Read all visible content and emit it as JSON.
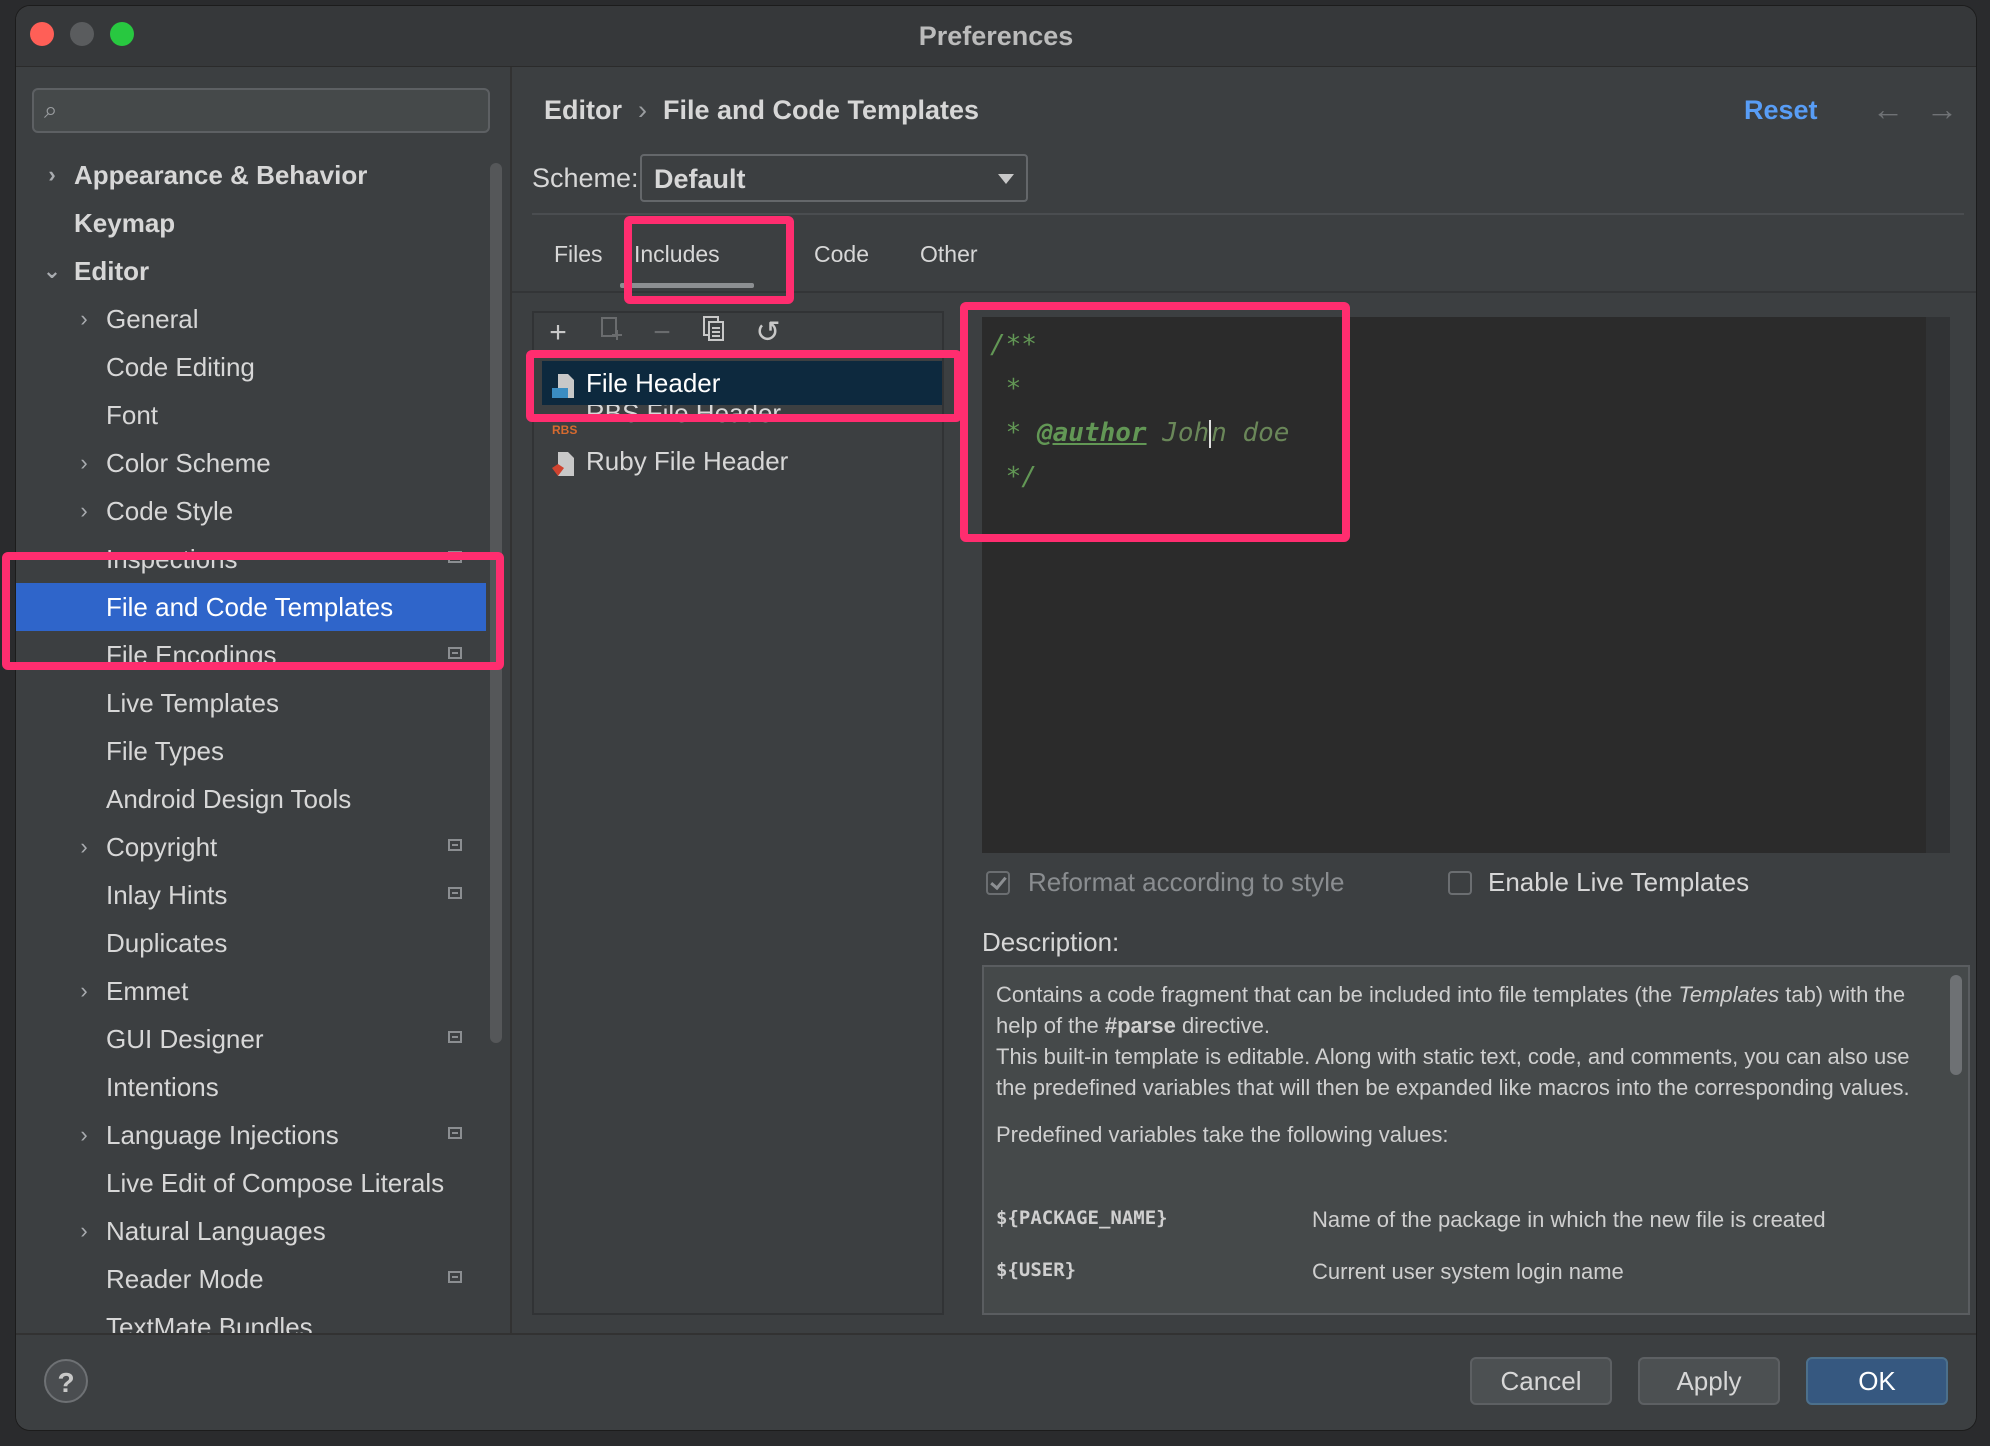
{
  "window": {
    "title": "Preferences"
  },
  "sidebar": {
    "search_placeholder": "",
    "items": [
      {
        "label": "Appearance & Behavior",
        "level": 0,
        "arrow": "›",
        "bold": true
      },
      {
        "label": "Keymap",
        "level": 0,
        "arrow": "",
        "bold": true
      },
      {
        "label": "Editor",
        "level": 0,
        "arrow": "⌄",
        "bold": true
      },
      {
        "label": "General",
        "level": 1,
        "arrow": "›"
      },
      {
        "label": "Code Editing",
        "level": 1,
        "arrow": ""
      },
      {
        "label": "Font",
        "level": 1,
        "arrow": ""
      },
      {
        "label": "Color Scheme",
        "level": 1,
        "arrow": "›"
      },
      {
        "label": "Code Style",
        "level": 1,
        "arrow": "›"
      },
      {
        "label": "Inspections",
        "level": 1,
        "arrow": "",
        "badge": true
      },
      {
        "label": "File and Code Templates",
        "level": 1,
        "arrow": "",
        "selected": true
      },
      {
        "label": "File Encodings",
        "level": 1,
        "arrow": "",
        "badge": true
      },
      {
        "label": "Live Templates",
        "level": 1,
        "arrow": ""
      },
      {
        "label": "File Types",
        "level": 1,
        "arrow": ""
      },
      {
        "label": "Android Design Tools",
        "level": 1,
        "arrow": ""
      },
      {
        "label": "Copyright",
        "level": 1,
        "arrow": "›",
        "badge": true
      },
      {
        "label": "Inlay Hints",
        "level": 1,
        "arrow": "",
        "badge": true
      },
      {
        "label": "Duplicates",
        "level": 1,
        "arrow": ""
      },
      {
        "label": "Emmet",
        "level": 1,
        "arrow": "›"
      },
      {
        "label": "GUI Designer",
        "level": 1,
        "arrow": "",
        "badge": true
      },
      {
        "label": "Intentions",
        "level": 1,
        "arrow": ""
      },
      {
        "label": "Language Injections",
        "level": 1,
        "arrow": "›",
        "badge": true
      },
      {
        "label": "Live Edit of Compose Literals",
        "level": 1,
        "arrow": ""
      },
      {
        "label": "Natural Languages",
        "level": 1,
        "arrow": "›"
      },
      {
        "label": "Reader Mode",
        "level": 1,
        "arrow": "",
        "badge": true
      },
      {
        "label": "TextMate Bundles",
        "level": 1,
        "arrow": ""
      }
    ]
  },
  "breadcrumb": {
    "parent": "Editor",
    "separator": "›",
    "current": "File and Code Templates"
  },
  "header": {
    "reset_label": "Reset",
    "back_glyph": "←",
    "forward_glyph": "→"
  },
  "scheme": {
    "label": "Scheme:",
    "value": "Default"
  },
  "tabs": [
    {
      "label": "Files"
    },
    {
      "label": "Includes",
      "active": true
    },
    {
      "label": "Code"
    },
    {
      "label": "Other"
    }
  ],
  "toolbar": {
    "add": "+",
    "remove": "−",
    "revert": "↺"
  },
  "templates": [
    {
      "label": "File Header",
      "selected": true,
      "icon": "java-file-icon"
    },
    {
      "label": "RBS File Header",
      "icon": "rbs-file-icon"
    },
    {
      "label": "Ruby File Header",
      "icon": "ruby-file-icon"
    }
  ],
  "editor": {
    "lines": [
      "/**",
      " *",
      " * ",
      " */"
    ],
    "author_tag": "@author",
    "author_value_before_cursor": " Joh",
    "author_value_after_cursor": "n doe"
  },
  "options": {
    "reformat_label": "Reformat according to style",
    "reformat_checked": true,
    "live_templates_label": "Enable Live Templates",
    "live_templates_checked": false
  },
  "description": {
    "label": "Description:",
    "p1_a": "Contains a code fragment that can be included into file templates (the ",
    "p1_em": "Templates",
    "p1_b": " tab) with the help of the ",
    "p1_strong": "#parse",
    "p1_c": " directive.",
    "p2": "This built-in template is editable. Along with static text, code, and comments, you can also use the predefined variables that will then be expanded like macros into the corresponding values.",
    "p3": "Predefined variables take the following values:",
    "vars": [
      {
        "name": "${PACKAGE_NAME}",
        "desc": "Name of the package in which the new file is created"
      },
      {
        "name": "${USER}",
        "desc": "Current user system login name"
      }
    ]
  },
  "footer": {
    "help": "?",
    "cancel": "Cancel",
    "apply": "Apply",
    "ok": "OK"
  },
  "colors": {
    "accent": "#2f65ca",
    "highlight": "#ff2d6f",
    "link": "#589df6",
    "comment": "#629755"
  }
}
